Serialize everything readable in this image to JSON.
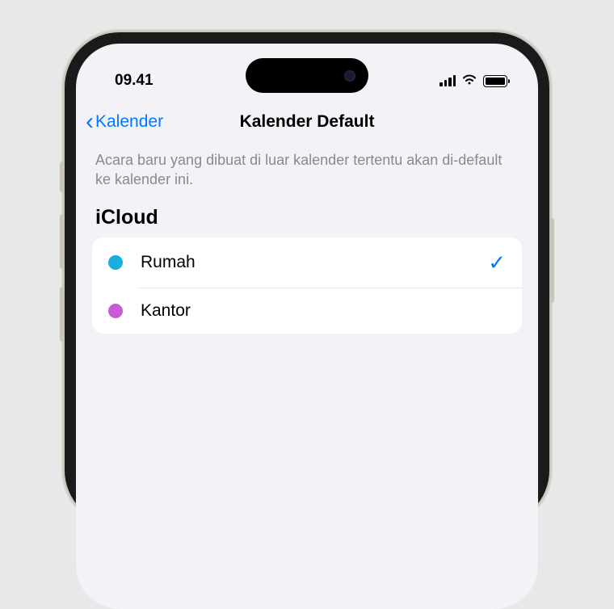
{
  "status_bar": {
    "time": "09.41"
  },
  "nav": {
    "back_label": "Kalender",
    "title": "Kalender Default"
  },
  "description": "Acara baru yang dibuat di luar kalender tertentu akan di-default ke kalender ini.",
  "section": {
    "header": "iCloud",
    "items": [
      {
        "label": "Rumah",
        "color": "#1badde",
        "selected": true
      },
      {
        "label": "Kantor",
        "color": "#c75dd4",
        "selected": false
      }
    ]
  }
}
